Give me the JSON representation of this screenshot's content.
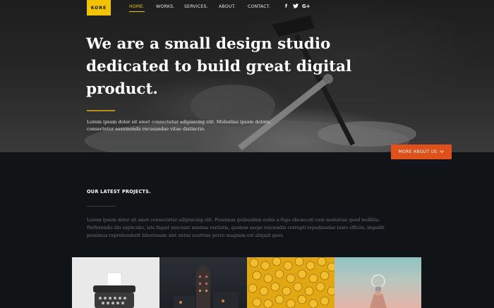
{
  "brand": {
    "logo_text": "KORE",
    "accent": "#f3c200",
    "button_color": "#e0501a"
  },
  "nav": {
    "items": [
      {
        "label": "HOME.",
        "active": true
      },
      {
        "label": "WORKS."
      },
      {
        "label": "SERVICES."
      },
      {
        "label": "ABOUT."
      },
      {
        "label": "CONTACT."
      }
    ],
    "social": [
      {
        "icon": "facebook-icon",
        "glyph": "f"
      },
      {
        "icon": "twitter-icon",
        "glyph": "🐦"
      },
      {
        "icon": "google-plus-icon",
        "glyph": "G+"
      }
    ]
  },
  "hero": {
    "headline_lines": [
      "We are a small design studio",
      "dedicated to build great digital",
      "product."
    ],
    "text_lines": [
      "Lorem ipsum dolor sit amet consectetur adipisicing elit. Molestias ipsam dolore,",
      "consectetur assumenda recusandae vitae distinctio."
    ],
    "button_label": "MORE ABOUT US",
    "button_icon": "chevron-down-icon"
  },
  "projects": {
    "title": "OUR LATEST PROJECTS.",
    "text_lines": [
      "Lorem ipsum dolor sit amet consectetur adipisicing elit. Possimus quibusdam nobis a fuga obcaecati cum molestias quod mollitia.",
      "Perferendis illo explicabo, iste fugiat nesciunt minima veritatis, quidem saepe reiciendis corrupti repudiandae iusto officiis, impedit",
      "possimus reprehenderit laboriosam sint animi nostrum porro magnam est aliquid quos."
    ],
    "tiles": [
      {
        "name": "typewriter"
      },
      {
        "name": "building-night"
      },
      {
        "name": "yellow-pasta"
      },
      {
        "name": "lightbulb"
      }
    ]
  }
}
